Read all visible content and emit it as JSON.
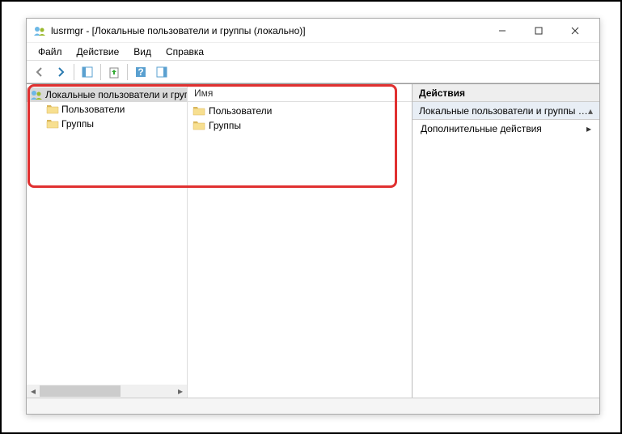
{
  "window": {
    "title": "lusrmgr - [Локальные пользователи и группы (локально)]"
  },
  "menubar": {
    "file": "Файл",
    "action": "Действие",
    "view": "Вид",
    "help": "Справка"
  },
  "tree": {
    "root": "Локальные пользователи и группы",
    "items": [
      "Пользователи",
      "Группы"
    ]
  },
  "list": {
    "column_name": "Имя",
    "rows": [
      "Пользователи",
      "Группы"
    ]
  },
  "actions": {
    "header": "Действия",
    "section": "Локальные пользователи и группы (л...",
    "more": "Дополнительные действия"
  }
}
